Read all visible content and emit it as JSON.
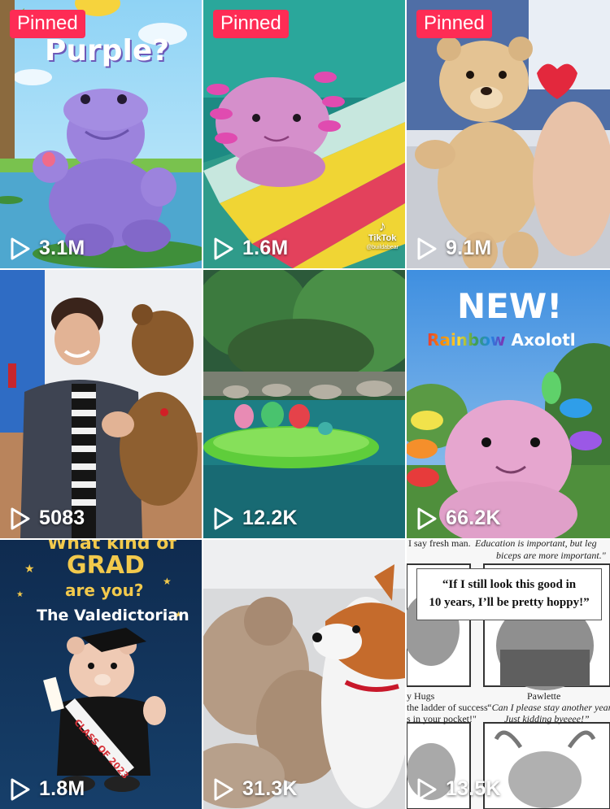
{
  "theme": {
    "pinned_color": "#fe2c55",
    "count_color": "#ffffff"
  },
  "videos": [
    {
      "pinned_label": "Pinned",
      "views": "3.1M",
      "overlay": "Purple?"
    },
    {
      "pinned_label": "Pinned",
      "views": "1.6M",
      "watermark": "TikTok",
      "watermark_handle": "@buildabear"
    },
    {
      "pinned_label": "Pinned",
      "views": "9.1M"
    },
    {
      "views": "5083"
    },
    {
      "views": "12.2K"
    },
    {
      "views": "66.2K",
      "overlay_new": "NEW!",
      "overlay_rainbow": "Rainbow",
      "overlay_axolotl": "Axolotl"
    },
    {
      "views": "1.8M",
      "overlay_top": "What kind of",
      "overlay_grad": "GRAD",
      "overlay_are_you": "are you?",
      "overlay_title": "The Valedictorian",
      "sash_text": "CLASS OF 2023"
    },
    {
      "views": "31.3K"
    },
    {
      "views": "13.5K",
      "top_left_caption": "I say fresh man.",
      "top_right_caption_1": "Education is important, but leg",
      "top_right_caption_2": "biceps are more important.\"",
      "quote_line_1": "“If I still look this good in",
      "quote_line_2": "10 years, I’ll be pretty hoppy!”",
      "left_name": "y Hugs",
      "left_caption_1": "the ladder of success",
      "left_caption_2": "s in your pocket!\"",
      "right_name": "Pawlette",
      "right_caption_1": "“Can I please stay another year??",
      "right_caption_2": "Just kidding byeeee!”"
    }
  ],
  "icons": {
    "play": "play-icon"
  }
}
